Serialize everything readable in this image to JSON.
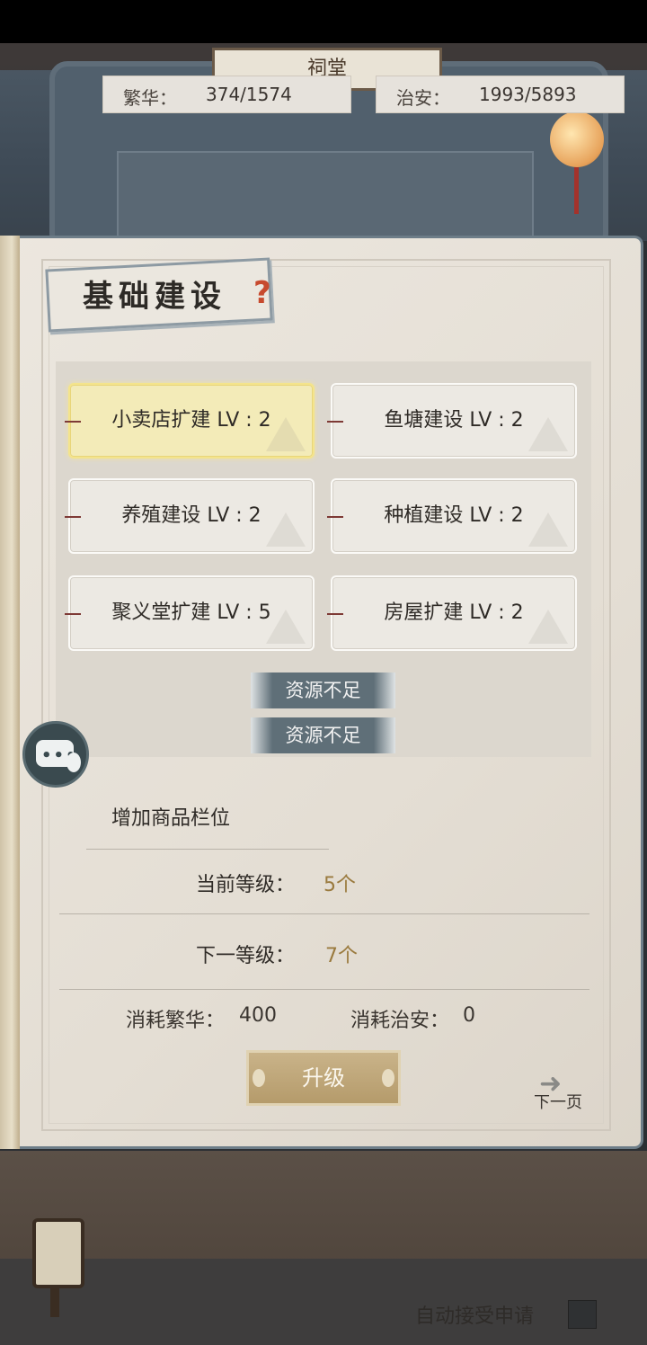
{
  "scene": {
    "hall_sign": "祠堂",
    "stats": {
      "prosperity_label": "繁华：",
      "prosperity_value": "374/1574",
      "security_label": "治安：",
      "security_value": "1993/5893"
    }
  },
  "panel": {
    "title": "基础建设",
    "help_icon": "?",
    "projects": [
      {
        "label": "小卖店扩建 LV : 2",
        "selected": true
      },
      {
        "label": "鱼塘建设 LV : 2",
        "selected": false
      },
      {
        "label": "养殖建设 LV : 2",
        "selected": false
      },
      {
        "label": "种植建设 LV : 2",
        "selected": false
      },
      {
        "label": "聚义堂扩建 LV : 5",
        "selected": false
      },
      {
        "label": "房屋扩建 LV : 2",
        "selected": false
      }
    ],
    "warnings": [
      "资源不足",
      "资源不足"
    ],
    "detail": {
      "description": "增加商品栏位",
      "current_level_label": "当前等级：",
      "current_level_value": "5个",
      "next_level_label": "下一等级：",
      "next_level_value": "7个",
      "cost_prosperity_label": "消耗繁华：",
      "cost_prosperity_value": "400",
      "cost_security_label": "消耗治安：",
      "cost_security_value": "0"
    },
    "upgrade_label": "升级",
    "next_page_label": "下一页"
  },
  "footer": {
    "auto_accept_label": "自动接受申请"
  },
  "colors": {
    "accent_gold": "#b59b6b",
    "level_value": "#9a7a3e",
    "warning_bg": "#5f6f78",
    "selected_item": "#f3ebb8"
  }
}
